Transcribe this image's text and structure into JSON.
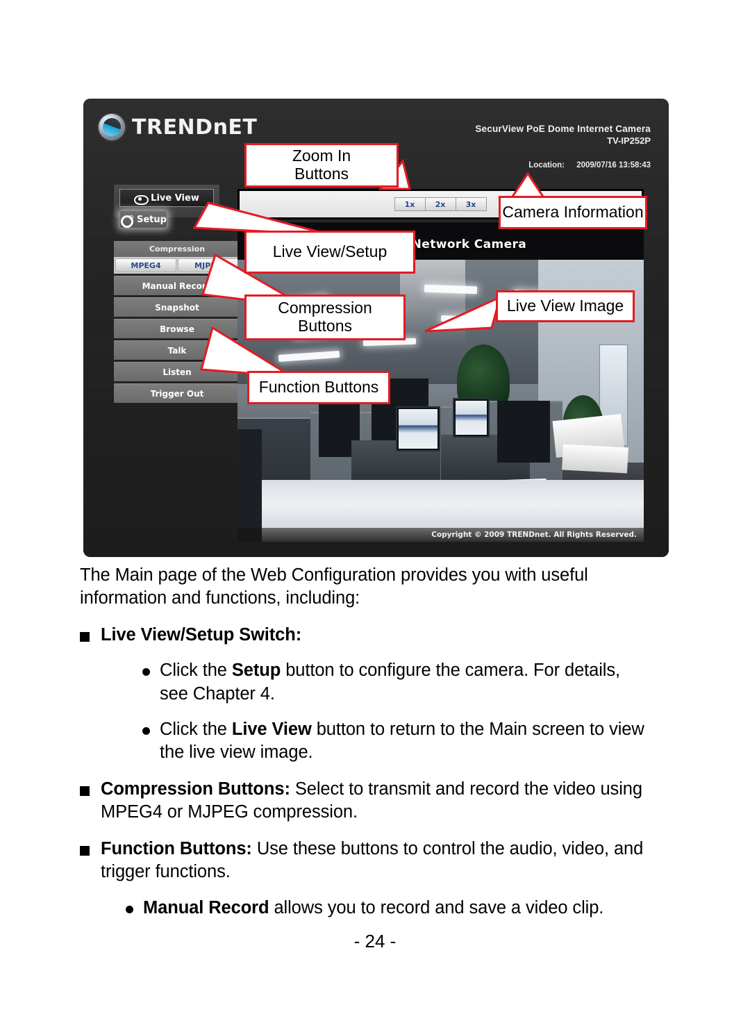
{
  "screenshot": {
    "brand": {
      "name": "TRENDnET",
      "logo_icon": "trendnet-globe-icon"
    },
    "camera_info": {
      "model_line1": "SecurView PoE Dome Internet Camera",
      "model_line2": "TV-IP252P",
      "location_label": "Location:",
      "timestamp": "2009/07/16 13:58:43"
    },
    "nav": {
      "live_view": "Live View",
      "setup": "Setup",
      "live_view_icon": "eye-icon",
      "setup_icon": "gear-icon"
    },
    "function_panel": {
      "compression_header": "Compression",
      "compression_tabs": [
        "MPEG4",
        "MJPEG"
      ],
      "buttons": [
        "Manual Record",
        "Snapshot",
        "Browse",
        "Talk",
        "Listen",
        "Trigger Out"
      ]
    },
    "zoom_buttons": [
      "1x",
      "2x",
      "3x"
    ],
    "video": {
      "title": "d Dome Network Camera",
      "copyright": "Copyright © 2009 TRENDnet. All Rights Reserved."
    },
    "callouts": {
      "zoom_in": "Zoom In\nButtons",
      "zoom_in_l1": "Zoom In",
      "zoom_in_l2": "Buttons",
      "live_view_setup": "Live View/Setup",
      "compression_l1": "Compression",
      "compression_l2": "Buttons",
      "function_buttons": "Function Buttons",
      "camera_information": "Camera Information",
      "live_view_image": "Live View Image"
    },
    "accent_color": "#e31b23"
  },
  "body": {
    "intro": "The Main page of the Web Configuration provides you with useful information and functions, including:",
    "item1_bold": "Live View/Setup Switch:",
    "item1_sub1_pre": "Click the ",
    "item1_sub1_bold": "Setup",
    "item1_sub1_post": " button to configure the camera. For details, see Chapter 4.",
    "item1_sub2_pre": "Click the ",
    "item1_sub2_bold": "Live View",
    "item1_sub2_post": " button to return to the Main screen to view the live view image.",
    "item2_bold": "Compression Buttons:",
    "item2_text": " Select to transmit and record the video using MPEG4 or MJPEG compression.",
    "item3_bold": "Function Buttons:",
    "item3_text": " Use these buttons to control the audio, video, and trigger functions.",
    "item3_sub1_bold": "Manual Record",
    "item3_sub1_text": " allows you to record and save a video clip.",
    "page_number": "- 24 -"
  }
}
